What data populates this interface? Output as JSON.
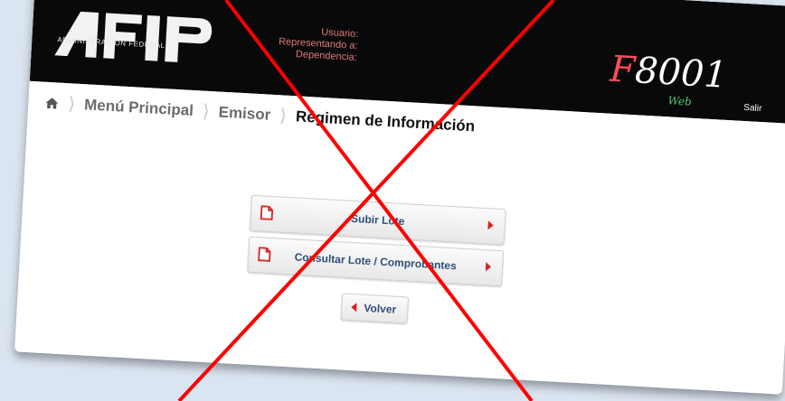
{
  "header": {
    "logo_caption": "ADMINISTRACION FEDERAL",
    "user_labels": [
      "Usuario:",
      "Representando a:",
      "Dependencia:"
    ],
    "brand_prefix": "F",
    "brand_number": "8001",
    "brand_sub": "Web",
    "logout_label": "Salir"
  },
  "breadcrumb": {
    "items": [
      "Menú Principal",
      "Emisor",
      "Régimen de Información"
    ]
  },
  "actions": {
    "upload_label": "Subir Lote",
    "query_label": "Consultar Lote / Comprobantes",
    "back_label": "Volver"
  },
  "colors": {
    "header_bg": "#090909",
    "brand_red": "#ff4b5a",
    "brand_green": "#55c86a",
    "link_blue": "#2f4f7a",
    "caret_red": "#d91f1f",
    "overlay_red": "#ff0000"
  },
  "icons": [
    "home-icon",
    "pdf-icon",
    "pdf-icon",
    "caret-right-icon",
    "caret-left-icon"
  ]
}
